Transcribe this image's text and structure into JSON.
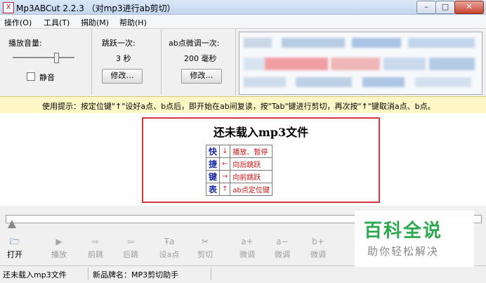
{
  "window": {
    "title": "Mp3ABCut 2.2.3 （对mp3进行ab剪切）",
    "app_icon": "X",
    "min": "–",
    "max": "□",
    "close": "✕"
  },
  "menu": [
    "操作(O)",
    "工具(T)",
    "捐助(M)",
    "帮助(H)"
  ],
  "volume": {
    "label": "播放音量:",
    "mute_label": "静音",
    "level": 0.7
  },
  "jump": {
    "label": "跳跃一次:",
    "value": "3 秒",
    "button": "修改…"
  },
  "ab": {
    "label": "ab点微调一次:",
    "value": "200 毫秒",
    "button": "修改…"
  },
  "hint": "使用提示：按定位键\"↑\"设好a点、b点后，即开始在ab间复读，按\"Tab\"键进行剪切，再次按\"↑\"键取消a点、b点。",
  "notice": {
    "title": "还未载入mp3文件",
    "shortcut_side": [
      "快",
      "捷",
      "键",
      "表"
    ],
    "shortcuts": [
      {
        "key": "↓",
        "desc": "播放、暂停"
      },
      {
        "key": "←",
        "desc": "向后跳跃"
      },
      {
        "key": "→",
        "desc": "向前跳跃"
      },
      {
        "key": "↑",
        "desc": "ab点定位键"
      }
    ]
  },
  "toolbar": [
    {
      "icon": "folder-icon",
      "glyph": "🗁",
      "label": "打开",
      "active": true
    },
    {
      "icon": "play-icon",
      "glyph": "▶",
      "label": "播放",
      "active": false
    },
    {
      "icon": "forward-jump-icon",
      "glyph": "⇨",
      "label": "前跳",
      "active": false
    },
    {
      "icon": "backward-jump-icon",
      "glyph": "⇦",
      "label": "后跳",
      "active": false
    },
    {
      "icon": "set-a-point-icon",
      "glyph": "Ŧa",
      "label": "设a点",
      "active": false
    },
    {
      "icon": "cut-icon",
      "glyph": "✂",
      "label": "剪切",
      "active": false
    },
    {
      "icon": "a-plus-icon",
      "glyph": "a+",
      "label": "微调",
      "active": false
    },
    {
      "icon": "a-minus-icon",
      "glyph": "a−",
      "label": "微调",
      "active": false
    },
    {
      "icon": "b-plus-icon",
      "glyph": "b+",
      "label": "微调",
      "active": false
    }
  ],
  "status": {
    "left": "还未载入mp3文件",
    "right": "新品牌名：MP3剪切助手"
  },
  "watermark": {
    "title": "百科全说",
    "subtitle": "助你轻松解决"
  }
}
